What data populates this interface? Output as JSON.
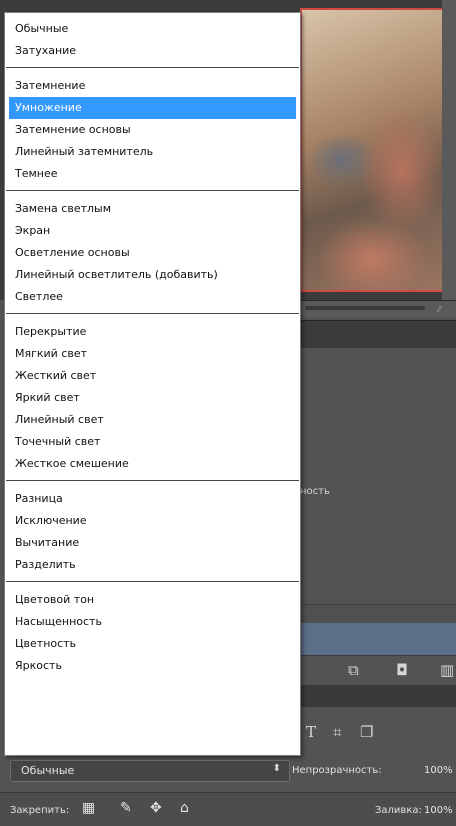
{
  "blend_menu": {
    "groups": [
      [
        "Обычные",
        "Затухание"
      ],
      [
        "Затемнение",
        "Умножение",
        "Затемнение основы",
        "Линейный затемнитель",
        "Темнее"
      ],
      [
        "Замена светлым",
        "Экран",
        "Осветление основы",
        "Линейный осветлитель (добавить)",
        "Светлее"
      ],
      [
        "Перекрытие",
        "Мягкий свет",
        "Жесткий свет",
        "Яркий свет",
        "Линейный свет",
        "Точечный свет",
        "Жесткое смешение"
      ],
      [
        "Разница",
        "Исключение",
        "Вычитание",
        "Разделить"
      ],
      [
        "Цветовой тон",
        "Насыщенность",
        "Цветность",
        "Яркость"
      ]
    ],
    "selected": "Умножение"
  },
  "layers_panel": {
    "partial_label": "ность",
    "blend_mode_value": "Обычные",
    "select_arrow": "⬍",
    "opacity_label": "Непрозрачность:",
    "opacity_value": "100%",
    "lock_label": "Закрепить:",
    "fill_label": "Заливка:",
    "fill_value": "100%"
  },
  "icons": {
    "panel_buttons": [
      "new-layer-icon",
      "camera-icon",
      "trash-icon"
    ],
    "tools": [
      "text-tool-icon",
      "transform-icon",
      "smart-object-icon"
    ],
    "locks": [
      "lock-transparent-icon",
      "lock-brush-icon",
      "lock-move-icon",
      "lock-all-icon"
    ]
  },
  "colors": {
    "menu_selection": "#3399ff",
    "layer_selected": "#5b6f88",
    "canvas_border": "#d04a44"
  }
}
